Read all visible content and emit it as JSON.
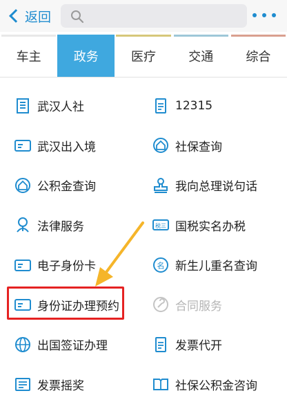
{
  "header": {
    "back_label": "返回",
    "accent_color": "#1f8ccf",
    "search_icon": "search-icon",
    "more_icon": "more-dots-icon"
  },
  "tabs": [
    {
      "label": "车主",
      "active": false,
      "color": "#e8e8e8"
    },
    {
      "label": "政务",
      "active": true,
      "color": "#3fa8df"
    },
    {
      "label": "医疗",
      "active": false,
      "color": "#d6c77a"
    },
    {
      "label": "交通",
      "active": false,
      "color": "#9ec7d8"
    },
    {
      "label": "综合",
      "active": false,
      "color": "#d9a08f"
    }
  ],
  "services": [
    {
      "left": {
        "label": "武汉人社",
        "icon": "building-icon"
      },
      "right": {
        "label": "12315",
        "icon": "document-icon"
      }
    },
    {
      "left": {
        "label": "武汉出入境",
        "icon": "id-card-icon"
      },
      "right": {
        "label": "社保查询",
        "icon": "house-shield-icon"
      }
    },
    {
      "left": {
        "label": "公积金查询",
        "icon": "house-shield-icon"
      },
      "right": {
        "label": "我向总理说句话",
        "icon": "stamp-icon"
      }
    },
    {
      "left": {
        "label": "法律服务",
        "icon": "judge-icon"
      },
      "right": {
        "label": "国税实名办税",
        "icon": "tax-badge-icon"
      }
    },
    {
      "left": {
        "label": "电子身份卡",
        "icon": "id-card-icon"
      },
      "right": {
        "label": "新生儿重名查询",
        "icon": "name-tag-icon"
      }
    },
    {
      "left": {
        "label": "身份证办理预约",
        "icon": "id-card-icon"
      },
      "right": {
        "label": "合同服务",
        "icon": "wrench-icon",
        "disabled": true
      }
    },
    {
      "left": {
        "label": "出国签证办理",
        "icon": "globe-icon"
      },
      "right": {
        "label": "发票代开",
        "icon": "document-icon"
      }
    },
    {
      "left": {
        "label": "发票摇奖",
        "icon": "ticket-icon"
      },
      "right": {
        "label": "社保公积金咨询",
        "icon": "book-icon"
      }
    }
  ],
  "annotation": {
    "highlight_color": "#e52222",
    "arrow_color": "#f5b52a"
  }
}
